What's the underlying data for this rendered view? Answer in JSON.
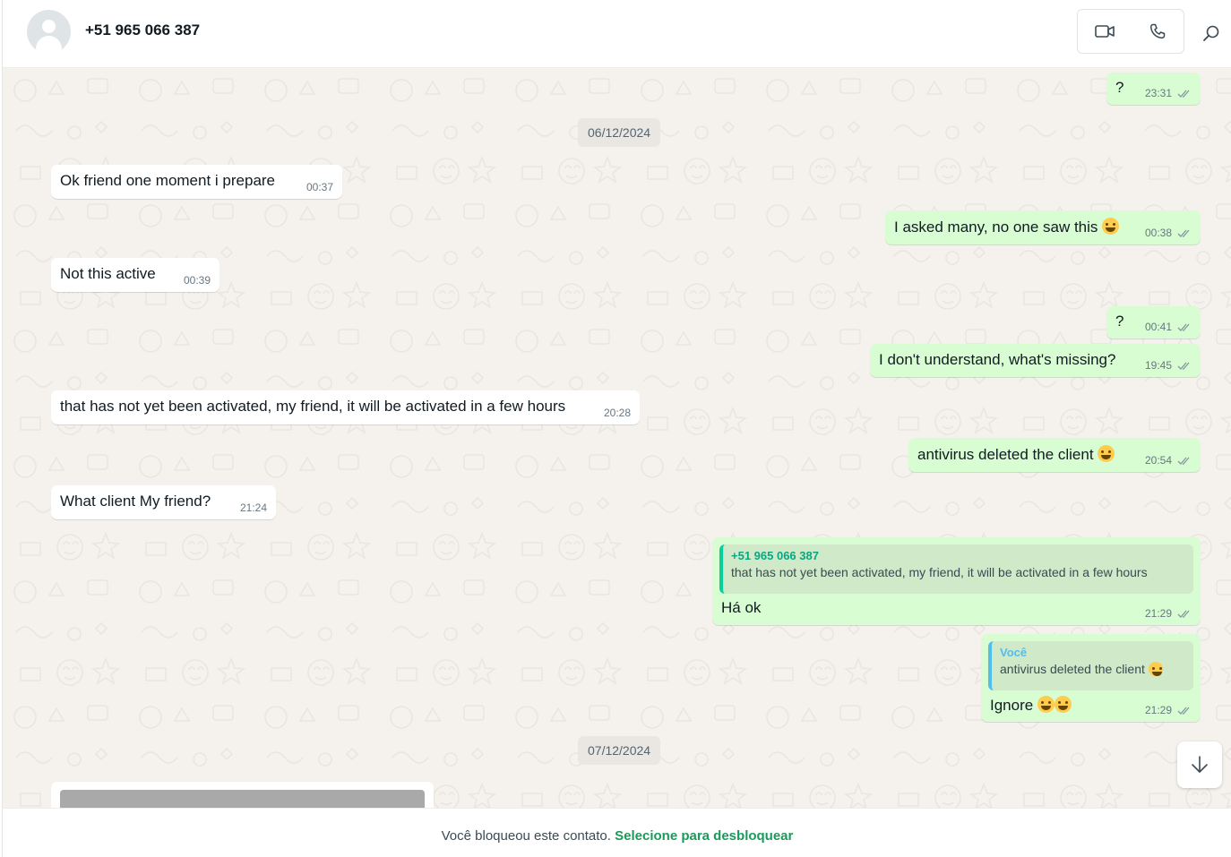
{
  "header": {
    "contact_name": "+51 965 066 387",
    "avatar_icon": "default-avatar-icon",
    "video_icon": "video-call-icon",
    "phone_icon": "phone-icon",
    "search_icon": "search-icon"
  },
  "colors": {
    "incoming": "#ffffff",
    "outgoing": "#d9fdd3",
    "accent": "#06cf9c",
    "unblock": "#1a9a5a"
  },
  "dates": {
    "first": "06/12/2024",
    "second": "07/12/2024"
  },
  "messages": [
    {
      "dir": "out",
      "text": "?",
      "time": "23:31",
      "status": "read"
    },
    {
      "dir": "in",
      "text": "Ok friend one moment i prepare",
      "time": "00:37"
    },
    {
      "dir": "out",
      "text": "I asked many, no one saw this",
      "emoji": "sweat-smile",
      "time": "00:38",
      "status": "read"
    },
    {
      "dir": "in",
      "text": "Not this active",
      "time": "00:39"
    },
    {
      "dir": "out",
      "text": "?",
      "time": "00:41",
      "status": "read"
    },
    {
      "dir": "out",
      "text": "I don't understand, what's missing?",
      "time": "19:45",
      "status": "read"
    },
    {
      "dir": "in",
      "text": "that has not yet been activated, my friend, it will be activated in a few hours",
      "time": "20:28"
    },
    {
      "dir": "out",
      "text": "antivirus deleted the client",
      "emoji": "sweat-smile",
      "time": "20:54",
      "status": "read"
    },
    {
      "dir": "in",
      "text": "What client My friend?",
      "time": "21:24"
    },
    {
      "dir": "out",
      "quote_author": "+51 965 066 387",
      "quote_text": "that has not yet been activated, my friend, it will be activated in a few hours",
      "text": "Há ok",
      "time": "21:29",
      "status": "read"
    },
    {
      "dir": "out",
      "quote_author": "Você",
      "quote_text": "antivirus deleted the client",
      "text": "Ignore",
      "emoji": "joy, sweat-smile",
      "time": "21:29",
      "status": "read"
    }
  ],
  "scroll_down_icon": "arrow-down-icon",
  "footer": {
    "blocked_text": "Você bloqueou este contato.",
    "unblock_link": "Selecione para desbloquear"
  }
}
